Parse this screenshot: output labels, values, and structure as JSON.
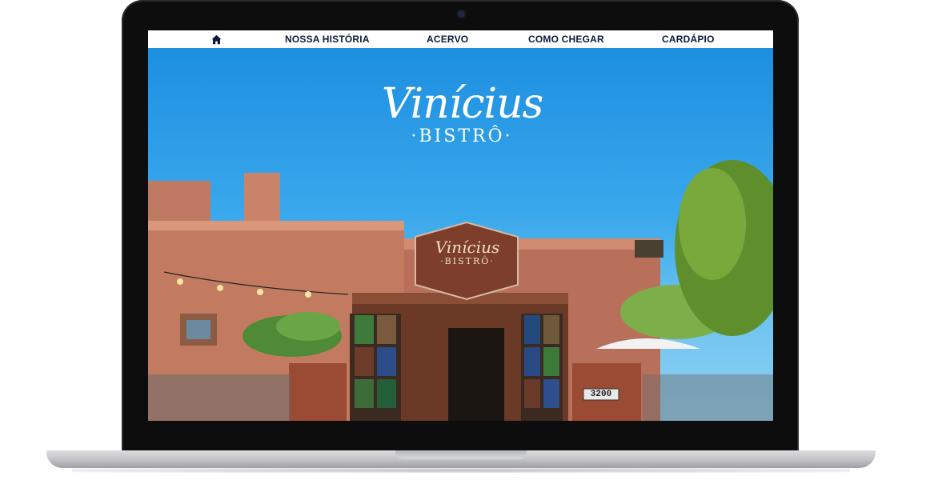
{
  "nav": {
    "home_icon": "home-icon",
    "items": [
      "NOSSA HISTÓRIA",
      "ACERVO",
      "COMO CHEGAR",
      "CARDÁPIO"
    ]
  },
  "hero": {
    "logo_main": "Vinícius",
    "logo_sub": "·BISTRÔ·",
    "sign_main": "Vinícius",
    "sign_sub": "·BISTRÔ·",
    "house_number": "3200"
  },
  "colors": {
    "nav_text": "#0b1a3c",
    "sky": "#2da1e4",
    "wall": "#c97a5f"
  }
}
